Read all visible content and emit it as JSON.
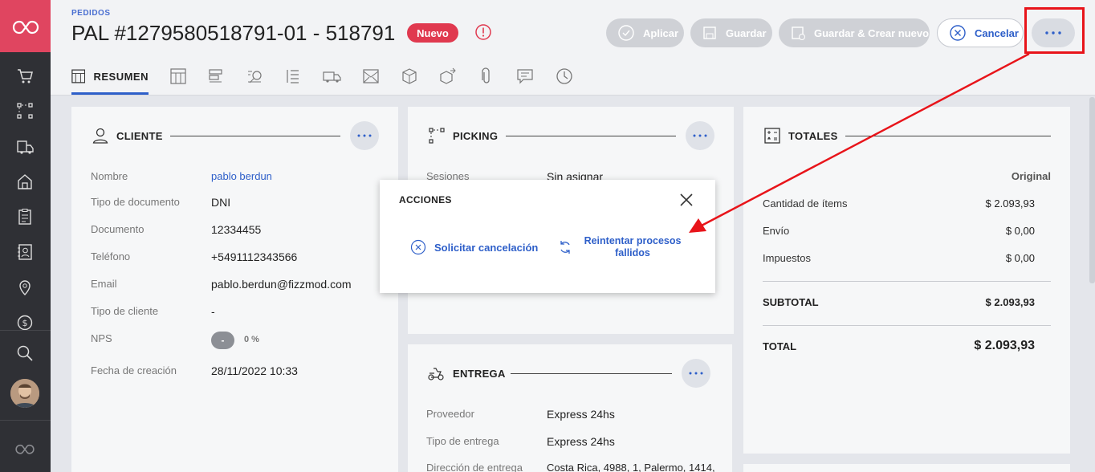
{
  "header": {
    "breadcrumb": "PEDIDOS",
    "title": "PAL #1279580518791-01 - 518791",
    "status_badge": "Nuevo",
    "buttons": {
      "apply": "Aplicar",
      "save": "Guardar",
      "save_new": "Guardar & Crear nuevo",
      "cancel": "Cancelar"
    }
  },
  "tabs": [
    {
      "label": "RESUMEN",
      "active": true
    }
  ],
  "cliente": {
    "title": "CLIENTE",
    "fields": [
      {
        "label": "Nombre",
        "value": "pablo berdun"
      },
      {
        "label": "Tipo de documento",
        "value": "DNI"
      },
      {
        "label": "Documento",
        "value": "12334455"
      },
      {
        "label": "Teléfono",
        "value": "+5491112343566"
      },
      {
        "label": "Email",
        "value": "pablo.berdun@fizzmod.com"
      },
      {
        "label": "Tipo de cliente",
        "value": "-"
      },
      {
        "label": "NPS",
        "value": "0 %",
        "pill": "-"
      },
      {
        "label": "Fecha de creación",
        "value": "28/11/2022 10:33"
      }
    ]
  },
  "picking": {
    "title": "PICKING",
    "sesiones_label": "Sesiones",
    "sesiones_value": "Sin asignar"
  },
  "entrega": {
    "title": "ENTREGA",
    "fields": [
      {
        "label": "Proveedor",
        "value": "Express 24hs"
      },
      {
        "label": "Tipo de entrega",
        "value": "Express 24hs"
      },
      {
        "label": "Dirección de entrega",
        "value": "Costa Rica, 4988, 1, Palermo, 1414,"
      }
    ]
  },
  "totales": {
    "title": "TOTALES",
    "column": "Original",
    "rows": [
      {
        "label": "Cantidad de ítems",
        "value": "$ 2.093,93"
      },
      {
        "label": "Envío",
        "value": "$ 0,00"
      },
      {
        "label": "Impuestos",
        "value": "$ 0,00"
      }
    ],
    "subtotal_label": "SUBTOTAL",
    "subtotal_value": "$ 2.093,93",
    "total_label": "TOTAL",
    "total_value": "$ 2.093,93"
  },
  "modal": {
    "title": "ACCIONES",
    "action1": "Solicitar cancelación",
    "action2_line1": "Reintentar procesos",
    "action2_line2": "fallidos"
  },
  "colors": {
    "brand": "#e04560",
    "accent": "#2e5fc9",
    "badge": "#e0394f",
    "annotation": "#e8141a"
  }
}
